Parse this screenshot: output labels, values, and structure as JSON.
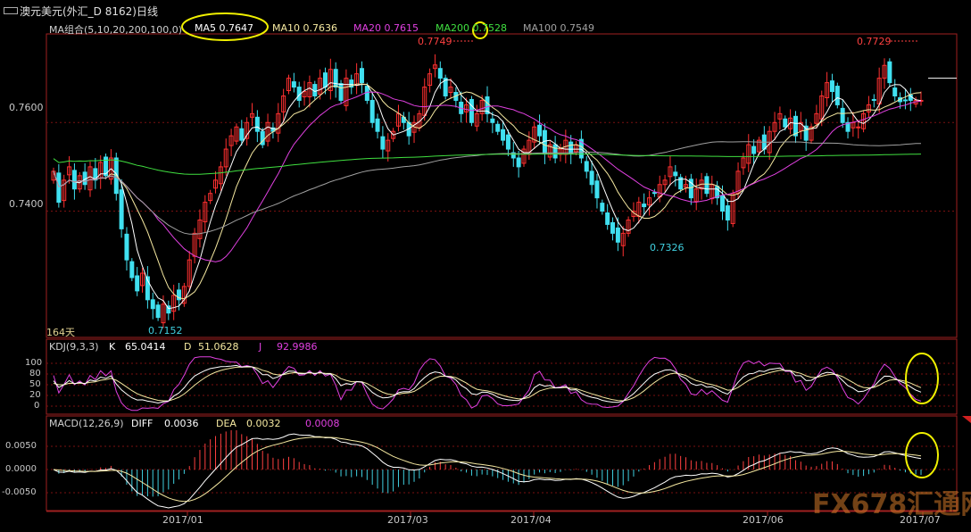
{
  "window": {
    "title": "澳元美元(外汇_D 8162)日线"
  },
  "legend": {
    "ma_group": "MA组合(5,10,20,200,100,0)",
    "ma5": "MA5 0.7647",
    "ma10": "MA10 0.7636",
    "ma20": "MA20 0.7615",
    "ma200": "MA200 0.7528",
    "ma100": "MA100 0.7549",
    "ma5_color": "#ffffff",
    "ma10_color": "#f5e8a0",
    "ma20_color": "#e040e0",
    "ma200_color": "#40e040",
    "ma100_color": "#a0a0a0"
  },
  "annotations": {
    "hi1": "0.7749",
    "hi2": "0.7729",
    "lo1": "0.7326",
    "lo2": "0.7152",
    "days": "164天"
  },
  "kdj": {
    "title": "KDJ(9,3,3)",
    "k_label": "K",
    "k": "65.0414",
    "d_label": "D",
    "d": "51.0628",
    "j_label": "J",
    "j": "92.9986",
    "ticks": [
      "100",
      "80",
      "50",
      "20",
      "0"
    ]
  },
  "macd": {
    "title": "MACD(12,26,9)",
    "diff_label": "DIFF",
    "diff": "0.0036",
    "dea_label": "DEA",
    "dea": "0.0032",
    "macd": "0.0008",
    "ticks": [
      "0.0050",
      "0.0000",
      "-0.0050"
    ]
  },
  "x_axis": {
    "labels": [
      "2017/01",
      "2017/03",
      "2017/04",
      "2017/06",
      "2017/07"
    ]
  },
  "watermark": {
    "text": "FX678汇通网"
  },
  "chart_data": {
    "type": "candlestick",
    "title": "澳元美元(外汇_D 8162)日线",
    "y_ticks": [
      "0.7600",
      "0.7400"
    ],
    "ylim": [
      0.7115,
      0.78
    ],
    "grid": true,
    "closes": [
      0.749,
      0.742,
      0.747,
      0.75,
      0.745,
      0.748,
      0.746,
      0.75,
      0.747,
      0.751,
      0.748,
      0.752,
      0.744,
      0.736,
      0.729,
      0.725,
      0.722,
      0.726,
      0.72,
      0.718,
      0.716,
      0.719,
      0.717,
      0.721,
      0.72,
      0.723,
      0.729,
      0.735,
      0.738,
      0.742,
      0.744,
      0.747,
      0.75,
      0.754,
      0.757,
      0.759,
      0.756,
      0.76,
      0.762,
      0.758,
      0.755,
      0.76,
      0.758,
      0.762,
      0.766,
      0.77,
      0.768,
      0.765,
      0.767,
      0.769,
      0.766,
      0.77,
      0.768,
      0.772,
      0.768,
      0.765,
      0.77,
      0.768,
      0.771,
      0.769,
      0.765,
      0.76,
      0.758,
      0.754,
      0.756,
      0.758,
      0.762,
      0.76,
      0.757,
      0.76,
      0.762,
      0.768,
      0.771,
      0.773,
      0.77,
      0.766,
      0.768,
      0.765,
      0.762,
      0.764,
      0.76,
      0.762,
      0.765,
      0.762,
      0.76,
      0.758,
      0.756,
      0.754,
      0.752,
      0.75,
      0.754,
      0.756,
      0.759,
      0.757,
      0.753,
      0.755,
      0.752,
      0.754,
      0.756,
      0.753,
      0.755,
      0.752,
      0.749,
      0.746,
      0.743,
      0.74,
      0.737,
      0.735,
      0.733,
      0.735,
      0.738,
      0.74,
      0.742,
      0.741,
      0.743,
      0.744,
      0.746,
      0.747,
      0.75,
      0.748,
      0.745,
      0.746,
      0.743,
      0.745,
      0.747,
      0.744,
      0.746,
      0.743,
      0.74,
      0.738,
      0.744,
      0.749,
      0.752,
      0.755,
      0.753,
      0.756,
      0.754,
      0.758,
      0.76,
      0.762,
      0.759,
      0.761,
      0.757,
      0.76,
      0.756,
      0.759,
      0.762,
      0.766,
      0.769,
      0.767,
      0.764,
      0.76,
      0.758,
      0.76,
      0.759,
      0.762,
      0.764,
      0.765,
      0.77,
      0.7729,
      0.769,
      0.766,
      0.7647,
      0.765,
      0.765,
      0.765,
      0.765
    ]
  }
}
